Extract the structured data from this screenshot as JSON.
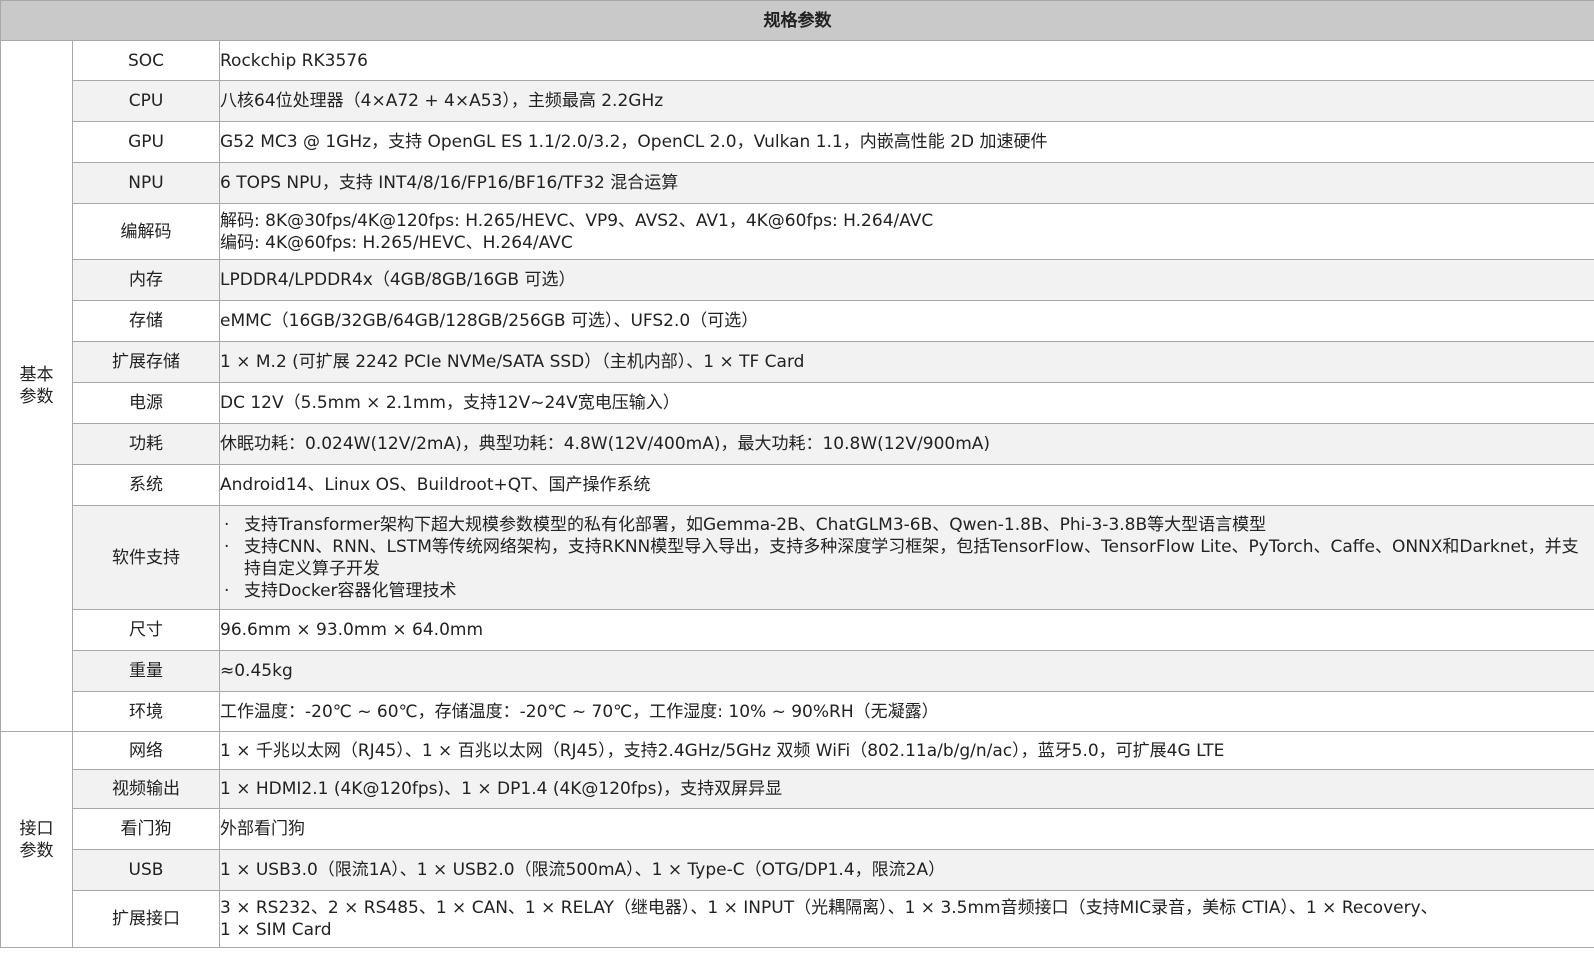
{
  "title": "规格参数",
  "sections": [
    {
      "name": "基本参数",
      "rows": [
        {
          "label": "SOC",
          "lines": [
            "Rockchip RK3576"
          ]
        },
        {
          "label": "CPU",
          "lines": [
            "八核64位处理器（4×A72 + 4×A53），主频最高 2.2GHz"
          ]
        },
        {
          "label": "GPU",
          "lines": [
            "G52 MC3 @ 1GHz，支持 OpenGL ES 1.1/2.0/3.2，OpenCL 2.0，Vulkan 1.1，内嵌高性能 2D 加速硬件"
          ]
        },
        {
          "label": "NPU",
          "lines": [
            "6 TOPS NPU，支持 INT4/8/16/FP16/BF16/TF32 混合运算"
          ]
        },
        {
          "label": "编解码",
          "lines": [
            "解码: 8K@30fps/4K@120fps: H.265/HEVC、VP9、AVS2、AV1，4K@60fps: H.264/AVC",
            "编码: 4K@60fps: H.265/HEVC、H.264/AVC"
          ]
        },
        {
          "label": "内存",
          "lines": [
            "LPDDR4/LPDDR4x（4GB/8GB/16GB 可选）"
          ]
        },
        {
          "label": "存储",
          "lines": [
            "eMMC（16GB/32GB/64GB/128GB/256GB 可选）、UFS2.0（可选）"
          ]
        },
        {
          "label": "扩展存储",
          "lines": [
            "1 × M.2 (可扩展 2242 PCIe NVMe/SATA SSD）（主机内部）、1 × TF Card"
          ]
        },
        {
          "label": "电源",
          "lines": [
            "DC 12V（5.5mm × 2.1mm，支持12V~24V宽电压输入）"
          ]
        },
        {
          "label": "功耗",
          "lines": [
            "休眠功耗：0.024W(12V/2mA)，典型功耗：4.8W(12V/400mA)，最大功耗：10.8W(12V/900mA)"
          ]
        },
        {
          "label": "系统",
          "lines": [
            "Android14、Linux OS、Buildroot+QT、国产操作系统"
          ]
        },
        {
          "label": "软件支持",
          "bullets": [
            "支持Transformer架构下超大规模参数模型的私有化部署，如Gemma-2B、ChatGLM3-6B、Qwen-1.8B、Phi-3-3.8B等大型语言模型",
            "支持CNN、RNN、LSTM等传统网络架构，支持RKNN模型导入导出，支持多种深度学习框架，包括TensorFlow、TensorFlow Lite、PyTorch、Caffe、ONNX和Darknet，并支持自定义算子开发",
            "支持Docker容器化管理技术"
          ]
        },
        {
          "label": "尺寸",
          "lines": [
            "96.6mm × 93.0mm × 64.0mm"
          ]
        },
        {
          "label": "重量",
          "lines": [
            "≈0.45kg"
          ]
        },
        {
          "label": "环境",
          "lines": [
            "工作温度：-20℃ ~ 60℃，存储温度：-20℃ ~ 70℃，工作湿度: 10% ~ 90%RH（无凝露）"
          ]
        }
      ]
    },
    {
      "name": "接口参数",
      "rows": [
        {
          "label": "网络",
          "lines": [
            "1 × 千兆以太网（RJ45）、1 × 百兆以太网（RJ45），支持2.4GHz/5GHz 双频 WiFi（802.11a/b/g/n/ac），蓝牙5.0，可扩展4G LTE"
          ]
        },
        {
          "label": "视频输出",
          "lines": [
            "1 × HDMI2.1 (4K@120fps)、1 × DP1.4 (4K@120fps)，支持双屏异显"
          ]
        },
        {
          "label": "看门狗",
          "lines": [
            "外部看门狗"
          ]
        },
        {
          "label": "USB",
          "lines": [
            "1 × USB3.0（限流1A）、1 × USB2.0（限流500mA）、1 × Type-C（OTG/DP1.4，限流2A）"
          ]
        },
        {
          "label": "扩展接口",
          "lines": [
            "3 × RS232、2 × RS485、1 × CAN、1 × RELAY（继电器）、1 × INPUT（光耦隔离）、1 × 3.5mm音频接口（支持MIC录音，美标 CTIA）、1 × Recovery、",
            "1 × SIM Card"
          ]
        }
      ]
    }
  ]
}
